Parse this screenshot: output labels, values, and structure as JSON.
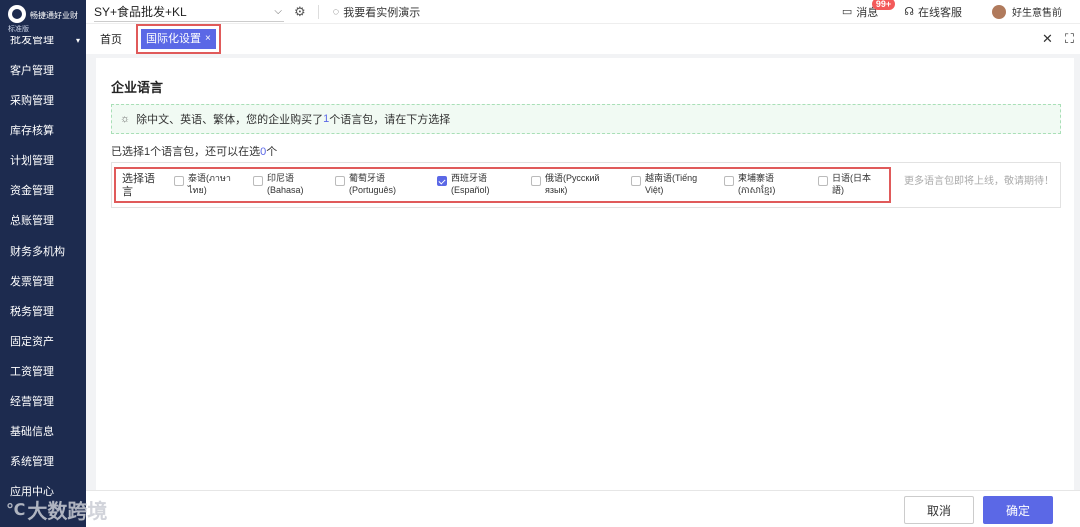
{
  "app": {
    "logo_text": "畅捷通好业财",
    "edition": "标准版",
    "company": "SY+食品批发+KL",
    "demo_label": "我要看实例演示",
    "messages_label": "消息",
    "messages_badge": "99+",
    "service_label": "在线客服",
    "user_name": "好生意售前"
  },
  "sidebar": {
    "partial_item": "批发管理",
    "items": [
      {
        "label": "客户管理"
      },
      {
        "label": "采购管理"
      },
      {
        "label": "库存核算"
      },
      {
        "label": "计划管理"
      },
      {
        "label": "资金管理"
      },
      {
        "label": "总账管理"
      },
      {
        "label": "财务多机构"
      },
      {
        "label": "发票管理"
      },
      {
        "label": "税务管理"
      },
      {
        "label": "固定资产"
      },
      {
        "label": "工资管理"
      },
      {
        "label": "经营管理"
      },
      {
        "label": "基础信息"
      },
      {
        "label": "系统管理"
      },
      {
        "label": "应用中心"
      }
    ]
  },
  "tabs": {
    "home": "首页",
    "active": "国际化设置",
    "close_glyph": "×"
  },
  "content": {
    "section_title": "企业语言",
    "tip_prefix": "除中文、英语、繁体，您的企业购买了",
    "tip_count": "1",
    "tip_suffix": "个语言包，请在下方选择",
    "selected_prefix": "已选择1个语言包，还可以在选",
    "selected_count": "0",
    "selected_suffix": "个",
    "language_label": "选择语言",
    "languages": [
      {
        "line1": "泰语(ภาษา",
        "line2": "ไทย)",
        "checked": false
      },
      {
        "line1": "印尼语",
        "line2": "(Bahasa)",
        "checked": false
      },
      {
        "line1": "葡萄牙语",
        "line2": "(Português)",
        "checked": false
      },
      {
        "line1": "西班牙语",
        "line2": "(Español)",
        "checked": true
      },
      {
        "line1": "俄语(Русский",
        "line2": "язык)",
        "checked": false
      },
      {
        "line1": "越南语(Tiếng",
        "line2": "Việt)",
        "checked": false
      },
      {
        "line1": "柬埔寨语",
        "line2": "(ភាសាខ្មែរ)",
        "checked": false
      },
      {
        "line1": "日语(日本",
        "line2": "語)",
        "checked": false
      }
    ],
    "coming_soon": "更多语言包即将上线，敬请期待！"
  },
  "footer": {
    "cancel": "取消",
    "confirm": "确定"
  },
  "watermark": "大数跨境",
  "colors": {
    "sidebar_bg": "#1d2b4f",
    "accent": "#5b68e6",
    "highlight_border": "#e05a5a",
    "badge": "#f35a5a"
  }
}
